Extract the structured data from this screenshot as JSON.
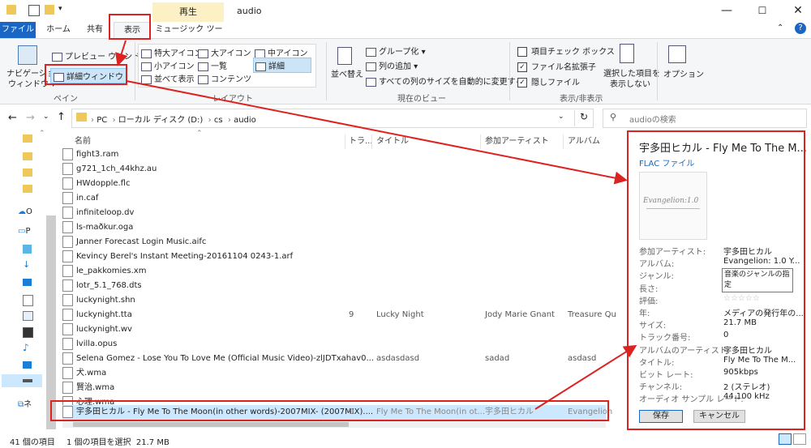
{
  "window": {
    "title": "audio",
    "play_tab": "再生",
    "min": "—",
    "max": "☐",
    "close": "✕"
  },
  "tabs": [
    {
      "label": "ファイル"
    },
    {
      "label": "ホーム"
    },
    {
      "label": "共有"
    },
    {
      "label": "表示"
    },
    {
      "label": "ミュージック ツール"
    }
  ],
  "ribbon": {
    "pane": {
      "nav_pane_1": "ナビゲーション",
      "nav_pane_2": "ウィンドウ ▾",
      "preview": "プレビュー ウィンドウ",
      "details": "詳細ウィンドウ",
      "group": "ペイン"
    },
    "layout": {
      "items": [
        "特大アイコン",
        "大アイコン",
        "中アイコン",
        "小アイコン",
        "一覧",
        "詳細",
        "並べて表示",
        "コンテンツ"
      ],
      "group": "レイアウト"
    },
    "current_view": {
      "sort": "並べ替え",
      "group_by": "グループ化 ▾",
      "add_column": "列の追加 ▾",
      "autosize": "すべての列のサイズを自動的に変更する",
      "group": "現在のビュー"
    },
    "show_hide": {
      "item_checkbox": "項目チェック ボックス",
      "file_ext": "ファイル名拡張子",
      "hidden": "隠しファイル",
      "hide_selected_1": "選択した項目を",
      "hide_selected_2": "表示しない",
      "group": "表示/非表示"
    },
    "options": "オプション"
  },
  "address": {
    "crumbs": [
      "PC",
      "ローカル ディスク (D:)",
      "cs",
      "audio"
    ],
    "search_placeholder": "audioの検索"
  },
  "columns": [
    "名前",
    "トラ...",
    "タイトル",
    "参加アーティスト",
    "アルバム"
  ],
  "files": [
    {
      "name": "fight3.ram"
    },
    {
      "name": "g721_1ch_44khz.au"
    },
    {
      "name": "HWdopple.flc"
    },
    {
      "name": "in.caf"
    },
    {
      "name": "infiniteloop.dv"
    },
    {
      "name": "ls-maðkur.oga"
    },
    {
      "name": "Janner Forecast Login Music.aifc"
    },
    {
      "name": "Kevincy Berel's Instant Meeting-20161104 0243-1.arf"
    },
    {
      "name": "le_pakkomies.xm"
    },
    {
      "name": "lotr_5.1_768.dts"
    },
    {
      "name": "luckynight.shn"
    },
    {
      "name": "luckynight.tta",
      "track": "9",
      "title": "Lucky Night",
      "artist": "Jody Marie Gnant",
      "album": "Treasure Qu"
    },
    {
      "name": "luckynight.wv"
    },
    {
      "name": "lvilla.opus"
    },
    {
      "name": "Selena Gomez - Lose You To Love Me (Official Music Video)-zlJDTxahav0...",
      "title": "asdasdasd",
      "artist": "sadad",
      "album": "asdasd"
    },
    {
      "name": "犬.wma"
    },
    {
      "name": "賢治.wma"
    },
    {
      "name": "心理.wma"
    },
    {
      "name": "宇多田ヒカル - Fly Me To The Moon(in other words)-2007MIX- (2007MIX)....",
      "track": "0",
      "title": "Fly Me To The Moon(in ot...",
      "artist": "宇多田ヒカル",
      "album": "Evangelion"
    }
  ],
  "nav": {
    "onedrive": "O",
    "pc": "P",
    "network": "ネ"
  },
  "details": {
    "title": "宇多田ヒカル - Fly Me To The M...",
    "type": "FLAC ファイル",
    "art_text": "Evangelion:1.0",
    "fields": [
      {
        "label": "参加アーティスト:",
        "value": "宇多田ヒカル"
      },
      {
        "label": "アルバム:",
        "value": "Evangelion: 1.0 Y..."
      },
      {
        "label": "ジャンル:",
        "value": ""
      },
      {
        "label": "長さ:",
        "value": ""
      },
      {
        "label": "評価:",
        "value": "☆☆☆☆☆"
      },
      {
        "label": "年:",
        "value": "メディアの発行年の..."
      },
      {
        "label": "サイズ:",
        "value": "21.7 MB"
      },
      {
        "label": "トラック番号:",
        "value": "0"
      },
      {
        "label": "アルバムのアーティスト:",
        "value": "宇多田ヒカル"
      },
      {
        "label": "タイトル:",
        "value": "Fly Me To The M..."
      },
      {
        "label": "ビット レート:",
        "value": "905kbps"
      },
      {
        "label": "チャンネル:",
        "value": "2 (ステレオ)"
      },
      {
        "label": "オーディオ サンプル レート:",
        "value": "44.100 kHz"
      }
    ],
    "genre_tooltip_1": "音楽のジャンルの指",
    "genre_tooltip_2": "定",
    "save": "保存",
    "cancel": "キャンセル"
  },
  "status": {
    "count": "41 個の項目",
    "selected": "1 個の項目を選択  21.7 MB"
  },
  "colors": {
    "accent": "#1a66c4",
    "annotation": "#dd2222",
    "selection": "#cce8ff"
  }
}
